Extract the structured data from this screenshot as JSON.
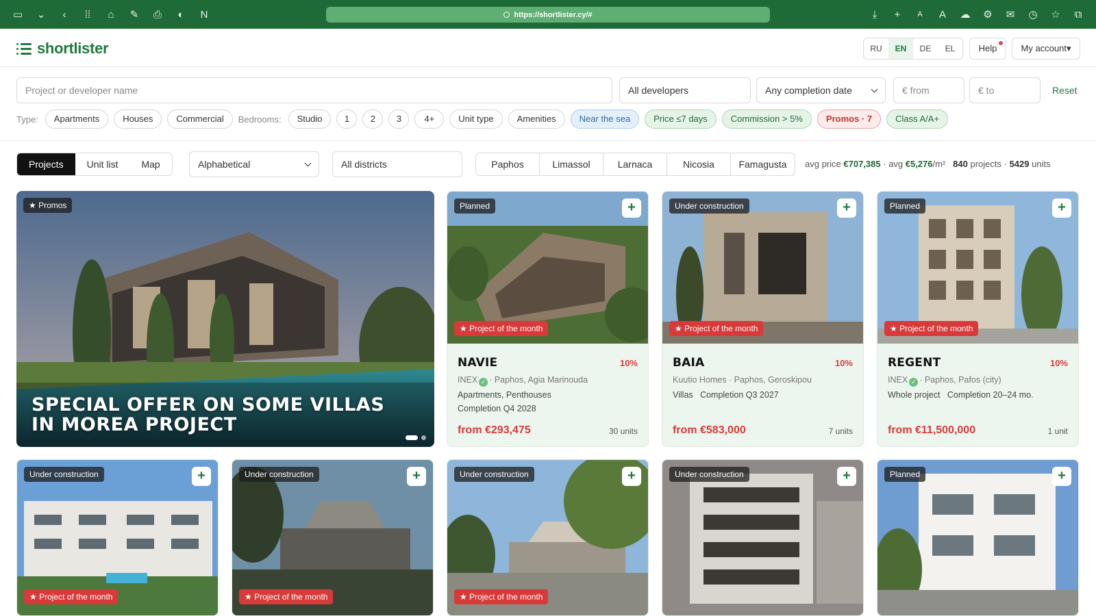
{
  "browser": {
    "url": "https://shortlister.cy/#"
  },
  "header": {
    "logo": "shortlister",
    "languages": [
      "RU",
      "EN",
      "DE",
      "EL"
    ],
    "active_language": "EN",
    "help": "Help",
    "account": "My account▾"
  },
  "filters": {
    "search_placeholder": "Project or developer name",
    "developers": "All developers",
    "completion": "Any completion date",
    "price_from_placeholder": "€ from",
    "price_to_placeholder": "€ to",
    "reset": "Reset",
    "type_label": "Type:",
    "types": [
      "Apartments",
      "Houses",
      "Commercial"
    ],
    "bedrooms_label": "Bedrooms:",
    "bedrooms": [
      "Studio",
      "1",
      "2",
      "3",
      "4+"
    ],
    "unit_type": "Unit type",
    "amenities": "Amenities",
    "near_sea": "Near the sea",
    "price_days": "Price ≤7 days",
    "commission": "Commission > 5%",
    "promos": "Promos · 7",
    "class": "Class A/A+"
  },
  "view": {
    "tabs": [
      "Projects",
      "Unit list",
      "Map"
    ],
    "active_tab": "Projects",
    "sort": "Alphabetical",
    "district_select": "All districts",
    "districts": [
      "Paphos",
      "Limassol",
      "Larnaca",
      "Nicosia",
      "Famagusta"
    ],
    "stats": {
      "avg_price_label": "avg price",
      "avg_price": "€707,385",
      "avg_sqm_label": "avg",
      "avg_sqm": "€5,276",
      "sqm_unit": "/m²",
      "projects_count": "840",
      "projects_label": "projects",
      "units_count": "5429",
      "units_label": "units"
    }
  },
  "promo_card": {
    "badge": "★ Promos",
    "title": "SPECIAL OFFER ON SOME VILLAS IN MOREA PROJECT"
  },
  "potm_label": "★ Project of the month",
  "cards": [
    {
      "status": "Planned",
      "name": "NAVIE",
      "commission": "10%",
      "developer": "INEX",
      "verified": true,
      "location": "· Paphos, Agia Marinouda",
      "line2": "Apartments, Penthouses",
      "line3": "Completion Q4 2028",
      "price": "from €293,475",
      "units": "30 units"
    },
    {
      "status": "Under construction",
      "name": "BAIA",
      "commission": "10%",
      "developer": "Kuutio Homes",
      "verified": false,
      "location": "· Paphos, Geroskipou",
      "line2": "Villas   Completion Q3 2027",
      "line3": "",
      "price": "from €583,000",
      "units": "7 units"
    },
    {
      "status": "Planned",
      "name": "REGENT",
      "commission": "10%",
      "developer": "INEX",
      "verified": true,
      "location": "· Paphos, Pafos (city)",
      "line2": "Whole project   Completion 20–24 mo.",
      "line3": "",
      "price": "from €11,500,000",
      "units": "1 unit"
    }
  ],
  "row2": [
    {
      "status": "Under construction",
      "potm": true
    },
    {
      "status": "Under construction",
      "potm": true
    },
    {
      "status": "Under construction",
      "potm": true
    },
    {
      "status": "Under construction",
      "potm": false
    },
    {
      "status": "Planned",
      "potm": false
    }
  ]
}
